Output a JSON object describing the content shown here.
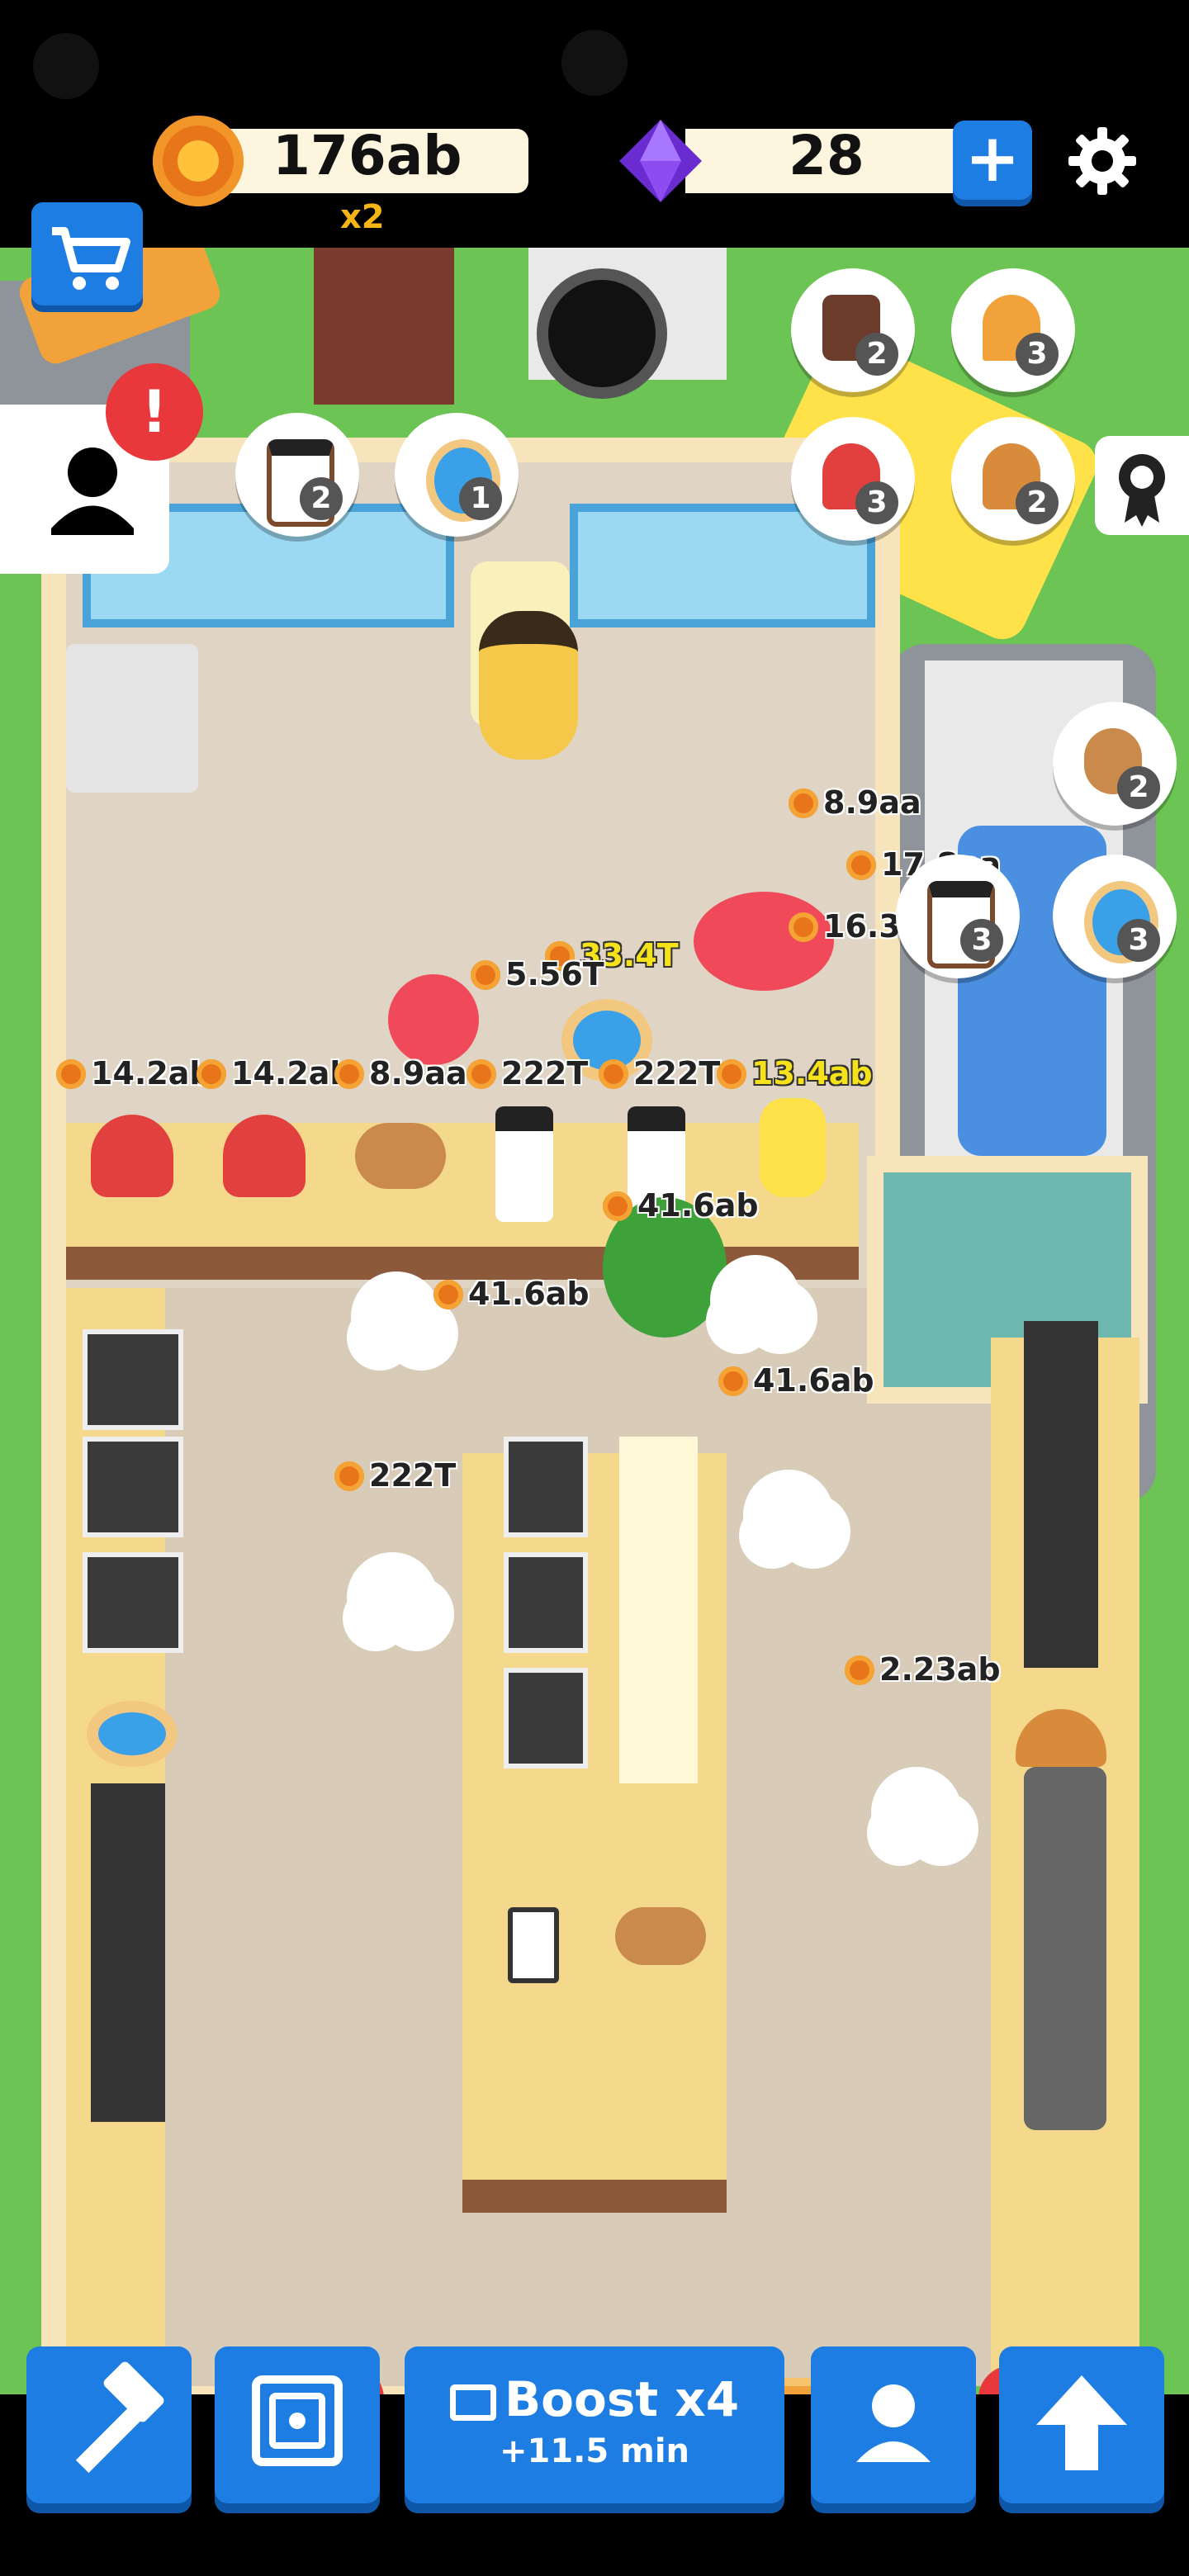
{
  "hud": {
    "coins": "176ab",
    "coin_multiplier": "x2",
    "gems": "28",
    "add_gems_label": "+"
  },
  "side": {
    "alert_label": "!"
  },
  "orders_left": [
    {
      "item": "coffee-icon",
      "count": "2"
    },
    {
      "item": "donut-icon",
      "count": "1"
    }
  ],
  "orders_right_top": [
    {
      "item": "milkshake-icon",
      "count": "2"
    },
    {
      "item": "icecream-icon",
      "count": "3"
    },
    {
      "item": "muffin-icon",
      "count": "3"
    },
    {
      "item": "croissant-icon",
      "count": "2"
    }
  ],
  "orders_right_mid": [
    {
      "item": "cookie-icon",
      "count": "2"
    },
    {
      "item": "coffee-icon",
      "count": "3"
    },
    {
      "item": "donut-icon",
      "count": "3"
    }
  ],
  "price_tags": [
    {
      "text": "8.9aa"
    },
    {
      "text": "17.8aa"
    },
    {
      "text": "16.3aa"
    },
    {
      "text": "33.4T",
      "highlight": true
    },
    {
      "text": "5.56T"
    },
    {
      "text": "14.2ab"
    },
    {
      "text": "14.2ab"
    },
    {
      "text": "8.9aa"
    },
    {
      "text": "222T"
    },
    {
      "text": "222T"
    },
    {
      "text": "13.4ab",
      "highlight": true
    },
    {
      "text": "41.6ab"
    },
    {
      "text": "41.6ab"
    },
    {
      "text": "41.6ab"
    },
    {
      "text": "222T"
    },
    {
      "text": "2.23ab"
    }
  ],
  "bottom_nav": {
    "build": "hammer-icon",
    "vault": "safe-icon",
    "boost_title": "Boost x4",
    "boost_sub": "+11.5 min",
    "staff": "person-icon",
    "upgrade": "up-arrow-icon"
  },
  "colors": {
    "primary_button": "#1e7de2",
    "alert": "#e8383b",
    "coin": "#e8751a",
    "highlight_price": "#f5e21a",
    "grass": "#6cc454"
  }
}
